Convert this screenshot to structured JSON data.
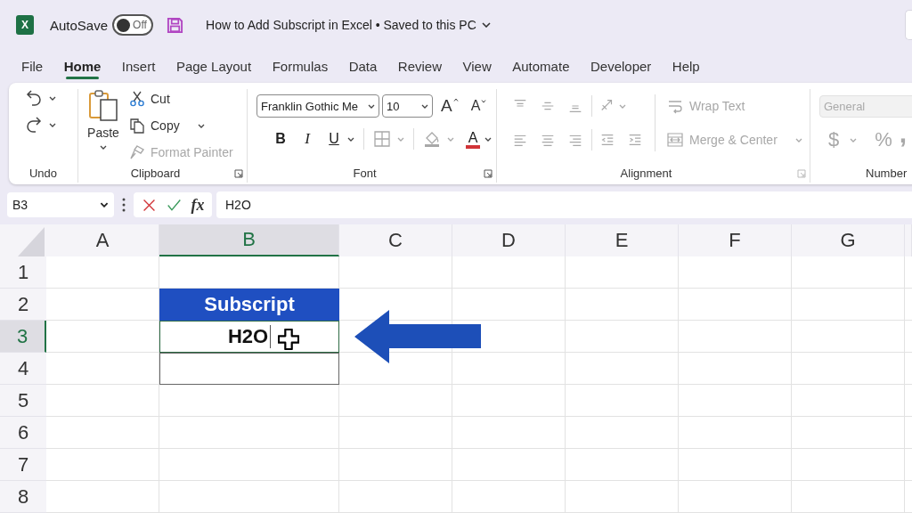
{
  "title_bar": {
    "logo_letter": "X",
    "autosave": {
      "label": "AutoSave",
      "on": false,
      "state_label": "Off"
    },
    "document_title": "How to Add Subscript in Excel • Saved to this PC"
  },
  "tabs": [
    {
      "label": "File",
      "selected": false
    },
    {
      "label": "Home",
      "selected": true
    },
    {
      "label": "Insert",
      "selected": false
    },
    {
      "label": "Page Layout",
      "selected": false
    },
    {
      "label": "Formulas",
      "selected": false
    },
    {
      "label": "Data",
      "selected": false
    },
    {
      "label": "Review",
      "selected": false
    },
    {
      "label": "View",
      "selected": false
    },
    {
      "label": "Automate",
      "selected": false
    },
    {
      "label": "Developer",
      "selected": false
    },
    {
      "label": "Help",
      "selected": false
    }
  ],
  "ribbon": {
    "undo": {
      "label": "Undo"
    },
    "clipboard": {
      "label": "Clipboard",
      "paste": "Paste",
      "cut": "Cut",
      "copy": "Copy",
      "format_painter": {
        "label": "Format Painter",
        "disabled": true
      }
    },
    "font": {
      "label": "Font",
      "font_name": "Franklin Gothic Me",
      "font_size": "10",
      "grow": "A",
      "shrink": "A",
      "bold": "B",
      "italic": "I",
      "underline": "U",
      "borders": {
        "disabled": true
      },
      "fill_color": {
        "disabled": true
      },
      "font_color": "A"
    },
    "alignment": {
      "label": "Alignment",
      "disabled": true,
      "wrap_text": "Wrap Text",
      "merge_center": "Merge & Center"
    },
    "number": {
      "label": "Number",
      "disabled": true,
      "format": "General",
      "currency": "$",
      "percent": "%",
      "comma": ","
    }
  },
  "formula_bar": {
    "name_box": "B3",
    "fx": "fx",
    "value": "H2O"
  },
  "sheet": {
    "columns": [
      {
        "label": "A",
        "selected": false
      },
      {
        "label": "B",
        "selected": true
      },
      {
        "label": "C",
        "selected": false
      },
      {
        "label": "D",
        "selected": false
      },
      {
        "label": "E",
        "selected": false
      },
      {
        "label": "F",
        "selected": false
      },
      {
        "label": "G",
        "selected": false
      }
    ],
    "rows": [
      {
        "label": "1",
        "selected": false
      },
      {
        "label": "2",
        "selected": false
      },
      {
        "label": "3",
        "selected": true
      },
      {
        "label": "4",
        "selected": false
      },
      {
        "label": "5",
        "selected": false
      },
      {
        "label": "6",
        "selected": false
      },
      {
        "label": "7",
        "selected": false
      },
      {
        "label": "8",
        "selected": false
      }
    ],
    "table": {
      "header": "Subscript",
      "rows": [
        {
          "value": "H2O",
          "selected": true,
          "editing": true
        },
        {
          "selected": false
        }
      ]
    }
  }
}
